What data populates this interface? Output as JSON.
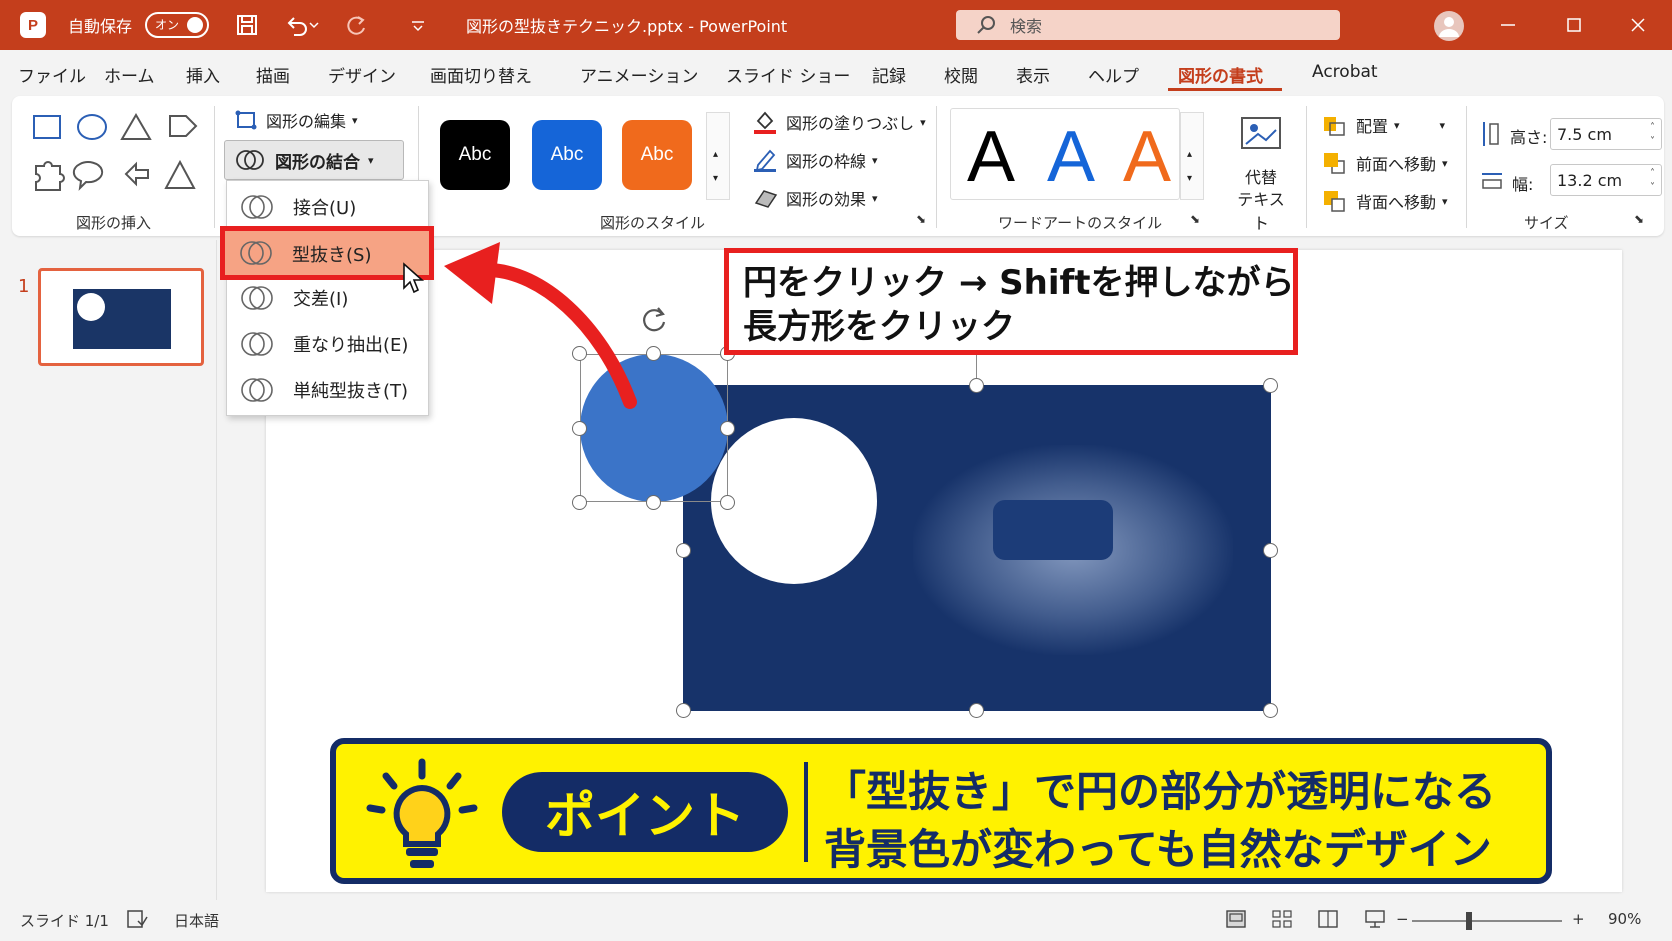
{
  "titlebar": {
    "logo": "P",
    "autosave_label": "自動保存",
    "toggle_label": "オン",
    "document_title": "図形の型抜きテクニック.pptx  -  PowerPoint",
    "search_placeholder": "検索",
    "icons": [
      "save-icon",
      "undo-icon",
      "redo-icon",
      "customize-icon",
      "search-icon",
      "user-avatar-icon",
      "minimize-icon",
      "maximize-icon",
      "close-icon"
    ]
  },
  "menu": {
    "tabs": [
      "ファイル",
      "ホーム",
      "挿入",
      "描画",
      "デザイン",
      "画面切り替え",
      "アニメーション",
      "スライド ショー",
      "記録",
      "校閲",
      "表示",
      "ヘルプ",
      "図形の書式",
      "Acrobat"
    ],
    "active_tab": "図形の書式"
  },
  "ribbon": {
    "insert_shapes": {
      "label": "図形の挿入"
    },
    "edit_shape_label": "図形の編集",
    "merge_shapes_label": "図形の結合",
    "shape_styles": {
      "label": "図形のスタイル",
      "swatches": [
        {
          "text": "Abc",
          "color": "#000000"
        },
        {
          "text": "Abc",
          "color": "#1565d8"
        },
        {
          "text": "Abc",
          "color": "#f06a1c"
        }
      ],
      "fill_label": "図形の塗りつぶし",
      "outline_label": "図形の枠線",
      "effects_label": "図形の効果"
    },
    "wordart": {
      "label": "ワードアートのスタイル",
      "letters": [
        {
          "text": "A",
          "color": "#000000"
        },
        {
          "text": "A",
          "color": "#1565d8"
        },
        {
          "text": "A",
          "color": "#f06a1c"
        }
      ]
    },
    "alt_text": {
      "line1": "代替",
      "line2": "テキスト"
    },
    "arrange": {
      "align_label": "配置",
      "bring_forward_label": "前面へ移動",
      "send_backward_label": "背面へ移動"
    },
    "size": {
      "label": "サイズ",
      "height_label": "高さ:",
      "height_value": "7.5 cm",
      "width_label": "幅:",
      "width_value": "13.2 cm"
    }
  },
  "merge_menu": {
    "items": [
      "接合(U)",
      "型抜き(S)",
      "交差(I)",
      "重なり抽出(E)",
      "単純型抜き(T)"
    ],
    "highlighted": "型抜き(S)"
  },
  "thumbnails": {
    "slide_number": "1"
  },
  "callout": {
    "line1": "円をクリック → Shiftを押しながら",
    "line2": "長方形をクリック"
  },
  "point_banner": {
    "pill": "ポイント",
    "line1": "「型抜き」で円の部分が透明になる",
    "line2": "背景色が変わっても自然なデザイン"
  },
  "statusbar": {
    "slide_info": "スライド 1/1",
    "language": "日本語",
    "zoom_minus": "−",
    "zoom_plus": "+",
    "zoom_level": "90%"
  },
  "colors": {
    "accent": "#c43e1c",
    "highlight_border": "#e8201f",
    "banner_yellow": "#fff200",
    "navy": "#142c66"
  }
}
